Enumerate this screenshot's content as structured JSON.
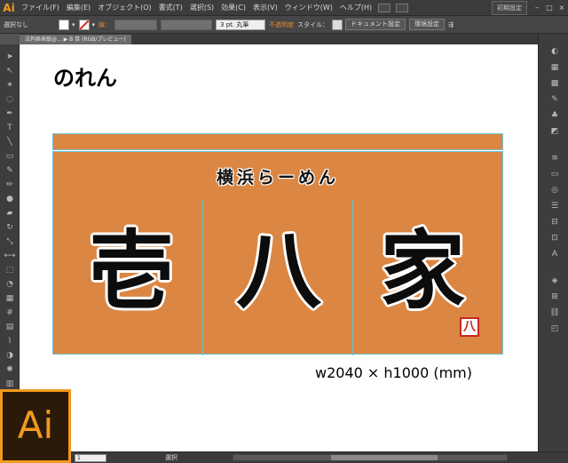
{
  "app": {
    "logo": "Ai",
    "workspace": "初期設定"
  },
  "menu": [
    "ファイル(F)",
    "編集(E)",
    "オブジェクト(O)",
    "書式(T)",
    "選択(S)",
    "効果(C)",
    "表示(V)",
    "ウィンドウ(W)",
    "ヘルプ(H)"
  ],
  "control_bar": {
    "selection_status": "選択なし",
    "stroke_label": "線：",
    "stroke_profile": "3 pt. 丸筆",
    "opacity_label": "不透明度",
    "style_label": "スタイル：",
    "doc_setup_button": "ドキュメント設定",
    "prefs_button": "環境設定"
  },
  "document_tab": "法判表表紙@... ▶ B 目 (RGB/プレビュー)",
  "artboard": {
    "title": "のれん",
    "shop_subtitle": "横浜らーめん",
    "shop_name_chars": [
      "壱",
      "八",
      "家"
    ],
    "seal_char": "八",
    "dimensions": "w2040 × h1000 (mm)"
  },
  "status": {
    "zoom": "1",
    "tool": "選択"
  },
  "colors": {
    "noren": "#db8642",
    "guide": "#6fc3d2",
    "seal": "#c72a1e",
    "ai_orange": "#f29a1c"
  },
  "tools": [
    "selection-icon",
    "direct-select-icon",
    "magic-wand-icon",
    "lasso-icon",
    "pen-icon",
    "type-icon",
    "line-icon",
    "rectangle-icon",
    "paintbrush-icon",
    "pencil-icon",
    "blob-brush-icon",
    "eraser-icon",
    "rotate-icon",
    "scale-icon",
    "width-icon",
    "free-transform-icon",
    "shape-builder-icon",
    "perspective-icon",
    "mesh-icon",
    "gradient-icon",
    "eyedropper-icon",
    "blend-icon",
    "symbol-sprayer-icon",
    "graph-icon",
    "artboard-icon",
    "slice-icon",
    "hand-icon",
    "zoom-icon"
  ],
  "panels": [
    "color-panel-icon",
    "color-guide-icon",
    "swatches-icon",
    "brushes-icon",
    "symbols-icon",
    "graphic-styles-icon",
    "stroke-icon",
    "gradient-panel-icon",
    "transparency-icon",
    "appearance-icon",
    "align-icon",
    "transform-icon",
    "character-icon",
    "layers-icon",
    "artboards-icon",
    "links-icon",
    "navigator-icon"
  ],
  "large_badge": "Ai"
}
